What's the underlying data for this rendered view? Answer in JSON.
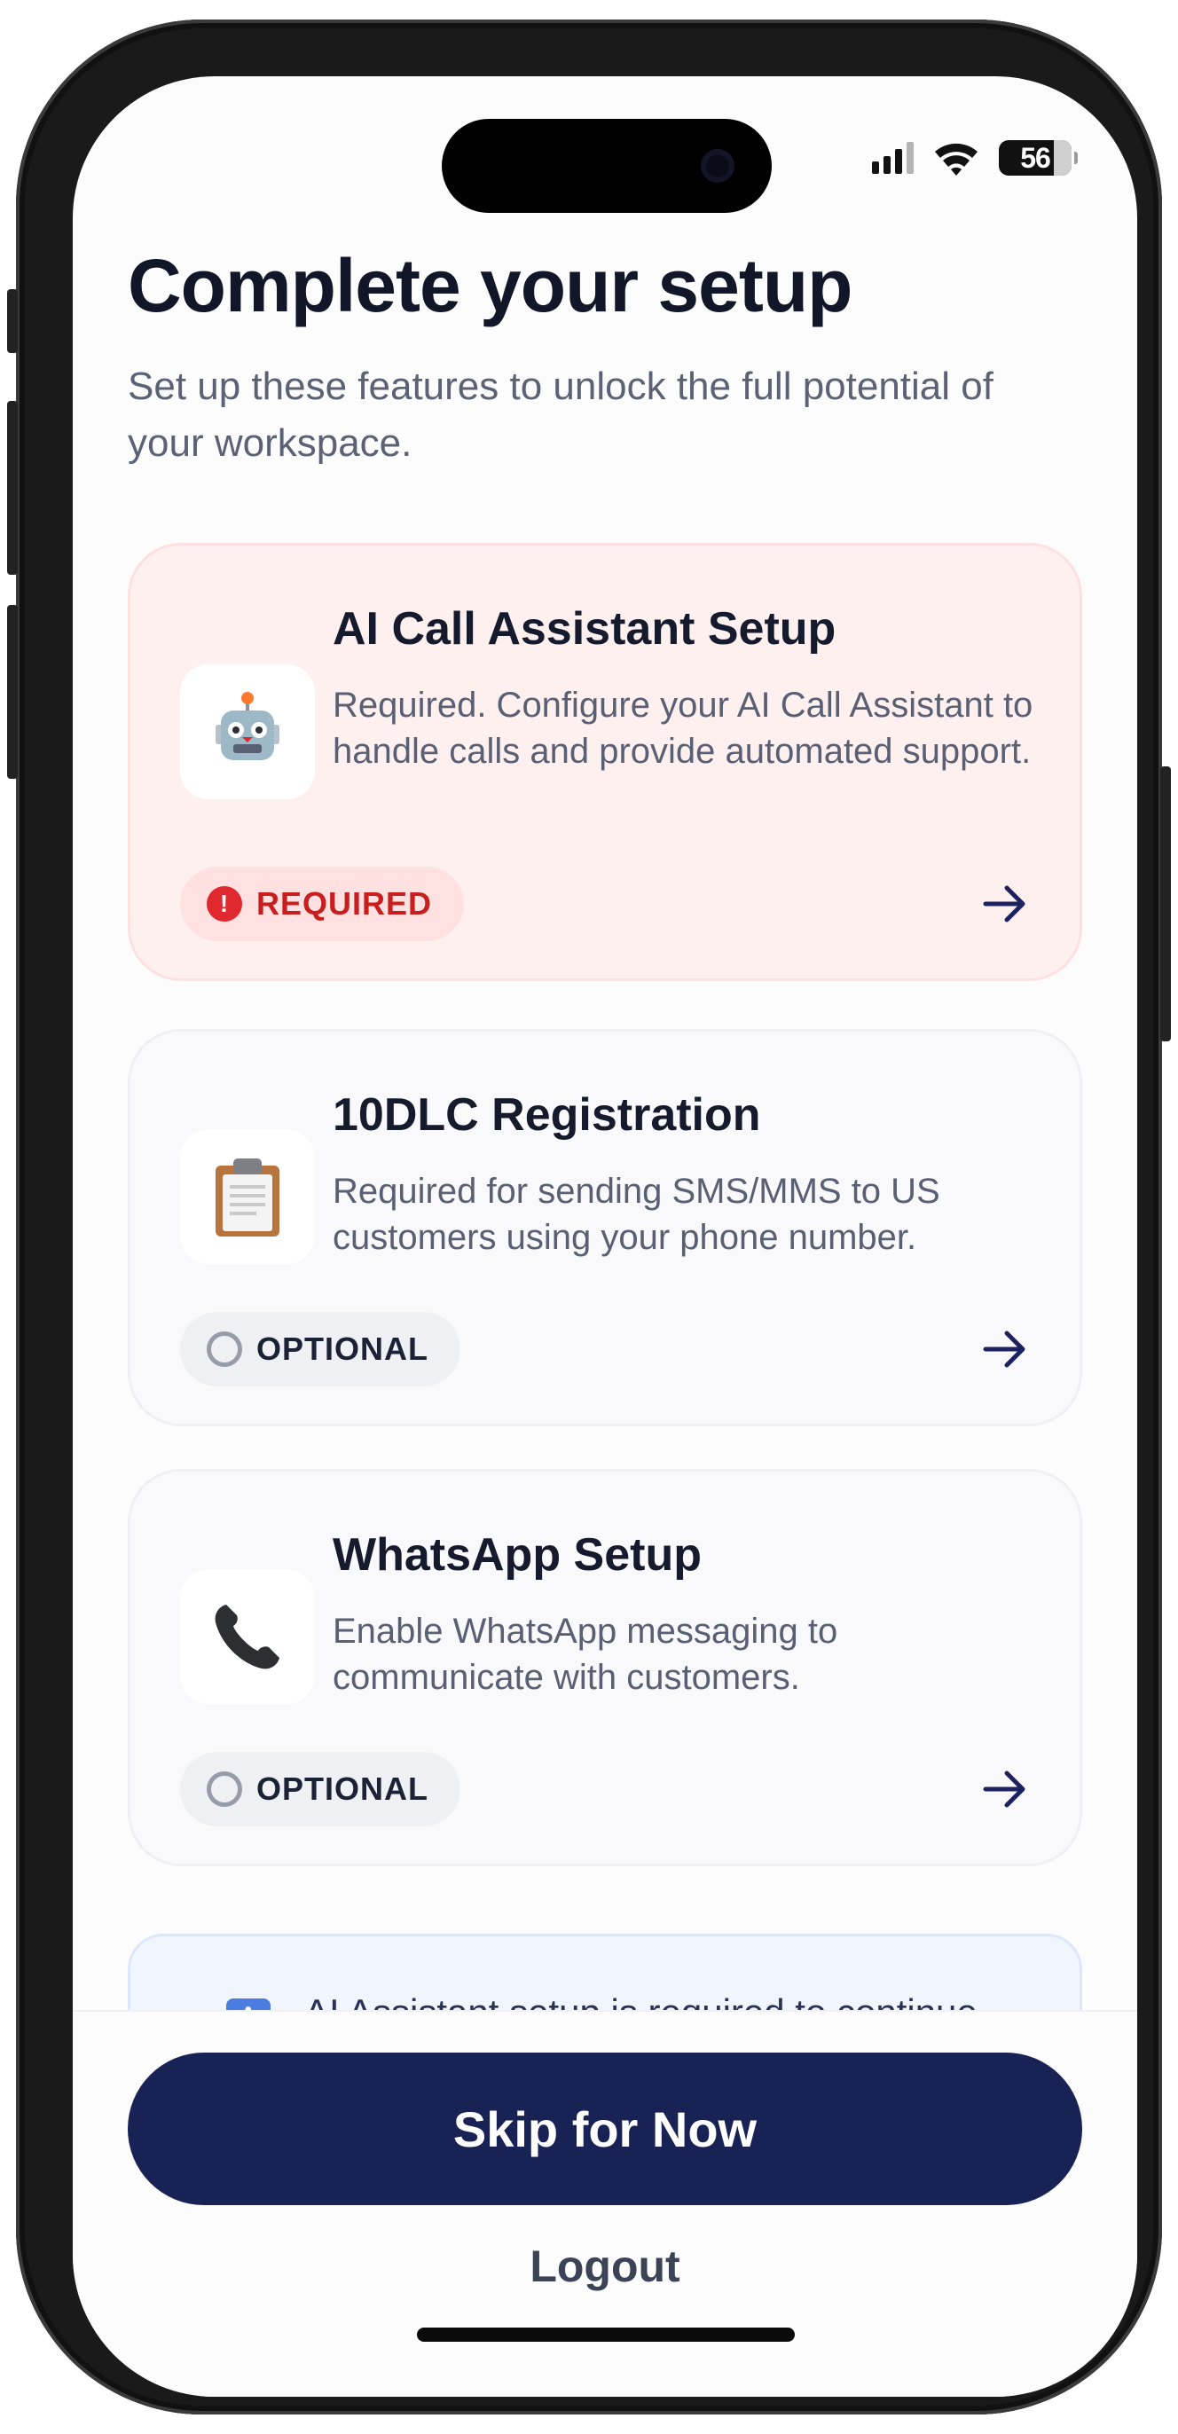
{
  "status_bar": {
    "battery": "56"
  },
  "header": {
    "title": "Complete your setup",
    "subtitle": "Set up these features to unlock the full potential of your workspace."
  },
  "cards": [
    {
      "title": "AI Call Assistant Setup",
      "description": "Required. Configure your AI Call Assistant to handle calls and provide automated support.",
      "badge": "REQUIRED",
      "icon": "robot-icon",
      "status": "required"
    },
    {
      "title": "10DLC Registration",
      "description": "Required for sending SMS/MMS to US customers using your phone number.",
      "badge": "OPTIONAL",
      "icon": "clipboard-icon",
      "status": "optional"
    },
    {
      "title": "WhatsApp Setup",
      "description": "Enable WhatsApp messaging to communicate with customers.",
      "badge": "OPTIONAL",
      "icon": "phone-icon",
      "status": "optional"
    }
  ],
  "info_banner": {
    "text": "AI Assistant setup is required to continue"
  },
  "actions": {
    "skip_label": "Skip for Now",
    "logout_label": "Logout"
  },
  "colors": {
    "primary": "#192254",
    "required_bg": "#fff0f0",
    "required_badge_text": "#c81e1e",
    "title": "#111629"
  }
}
